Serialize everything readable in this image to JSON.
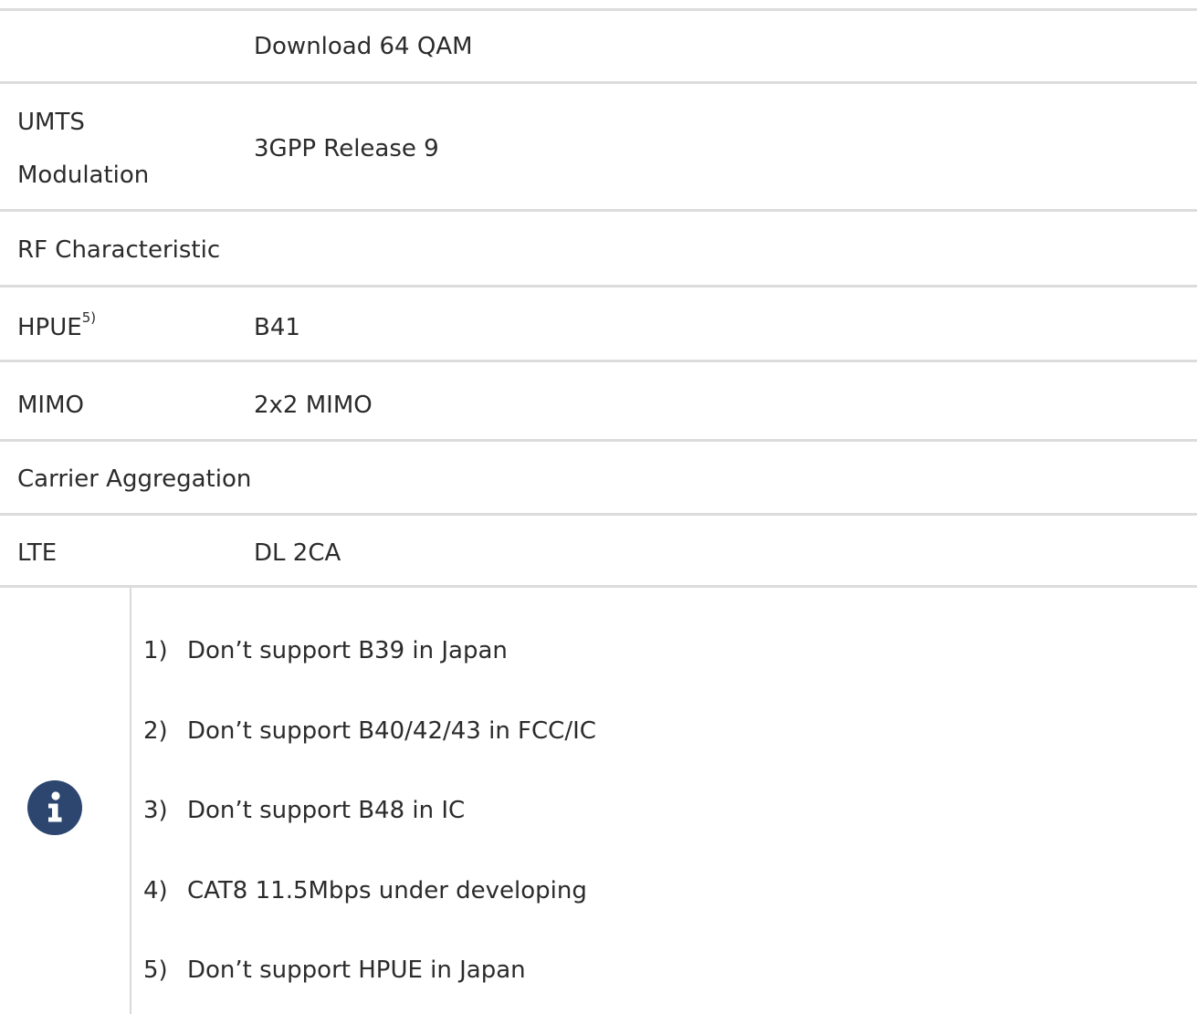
{
  "rows": {
    "download": {
      "value": "Download 64 QAM"
    },
    "umts": {
      "label_line1": "UMTS",
      "label_line2": "Modulation",
      "value": "3GPP Release 9"
    },
    "rf": {
      "section": "RF Characteristic"
    },
    "hpue": {
      "label": "HPUE",
      "label_sup": "5)",
      "value": "B41"
    },
    "mimo": {
      "label": "MIMO",
      "value": "2x2 MIMO"
    },
    "ca": {
      "section": "Carrier Aggregation"
    },
    "lte": {
      "label": "LTE",
      "value": "DL 2CA"
    }
  },
  "notes": {
    "icon": "info-icon",
    "items": [
      {
        "num": "1)",
        "text": "Don’t support B39 in Japan"
      },
      {
        "num": "2)",
        "text": "Don’t support B40/42/43 in FCC/IC"
      },
      {
        "num": "3)",
        "text": "Don’t support B48 in IC"
      },
      {
        "num": "4)",
        "text": "CAT8 11.5Mbps under developing"
      },
      {
        "num": "5)",
        "text": "Don’t support HPUE in Japan"
      }
    ]
  },
  "colors": {
    "icon": "#2c4670",
    "divider": "#dcdcdc",
    "text": "#2b2b2b"
  }
}
